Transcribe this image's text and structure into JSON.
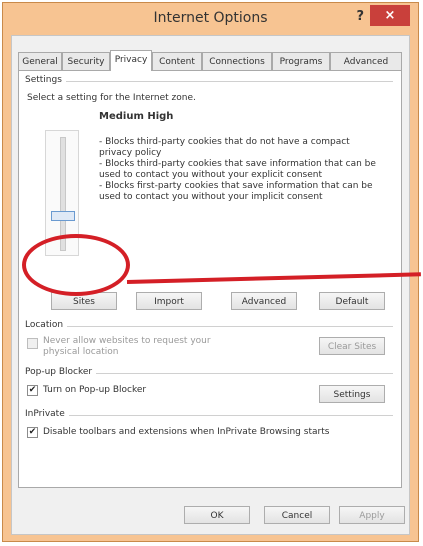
{
  "window": {
    "title": "Internet Options",
    "help_label": "?",
    "close_label": "×"
  },
  "tabs": [
    {
      "label": "General"
    },
    {
      "label": "Security"
    },
    {
      "label": "Privacy"
    },
    {
      "label": "Content"
    },
    {
      "label": "Connections"
    },
    {
      "label": "Programs"
    },
    {
      "label": "Advanced"
    }
  ],
  "privacy": {
    "settings": {
      "group_label": "Settings",
      "description": "Select a setting for the Internet zone.",
      "level_name": "Medium High",
      "level_fraction": 0.67,
      "bullets": [
        "- Blocks third-party cookies that do not have a compact privacy policy",
        "- Blocks third-party cookies that save information that can be used to contact you without your explicit consent",
        "- Blocks first-party cookies that save information that can be used to contact you without your implicit consent"
      ],
      "buttons": {
        "sites": "Sites",
        "import": "Import",
        "advanced": "Advanced",
        "default": "Default"
      }
    },
    "location": {
      "group_label": "Location",
      "never_allow_label": "Never allow websites to request your physical location",
      "clear_sites_label": "Clear Sites"
    },
    "popup": {
      "group_label": "Pop-up Blocker",
      "turn_on_label": "Turn on Pop-up Blocker",
      "settings_label": "Settings"
    },
    "inprivate": {
      "group_label": "InPrivate",
      "disable_label": "Disable toolbars and extensions when InPrivate Browsing starts"
    }
  },
  "footer": {
    "ok": "OK",
    "cancel": "Cancel",
    "apply": "Apply"
  },
  "colors": {
    "frame": "#f7c492",
    "close": "#c9403b",
    "highlight": "#d41f26"
  }
}
